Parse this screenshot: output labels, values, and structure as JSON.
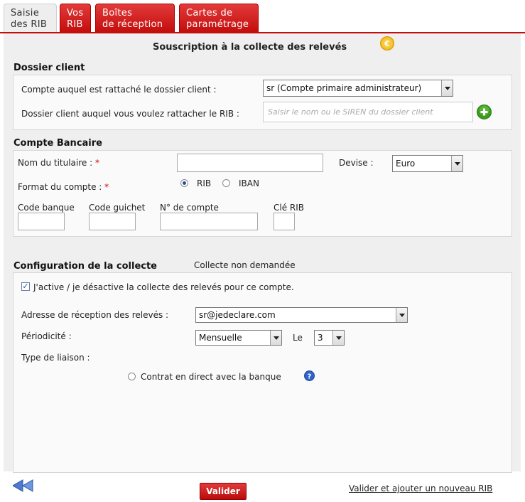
{
  "tabs": [
    {
      "label_line1": "Saisie",
      "label_line2": "des RIB"
    },
    {
      "label_line1": "Vos",
      "label_line2": "RIB"
    },
    {
      "label_line1": "Boîtes",
      "label_line2": "de réception"
    },
    {
      "label_line1": "Cartes de",
      "label_line2": "paramétrage"
    }
  ],
  "page_title": "Souscription à la collecte des relevés",
  "icons": {
    "currency": "euro-coin-icon",
    "add": "plus-circle-icon",
    "help": "question-icon",
    "back": "double-arrow-left-icon"
  },
  "dossier": {
    "title": "Dossier client",
    "compte_label": "Compte auquel est rattaché le dossier client :",
    "compte_value": "sr (Compte primaire administrateur)",
    "rattacher_label": "Dossier client auquel vous voulez rattacher le RIB :",
    "rattacher_placeholder": "Saisir le nom ou le SIREN du dossier client"
  },
  "compte": {
    "title": "Compte Bancaire",
    "titulaire_label": "Nom du titulaire :",
    "required_mark": "*",
    "devise_label": "Devise :",
    "devise_value": "Euro",
    "format_label": "Format du compte :",
    "format_rib": "RIB",
    "format_iban": "IBAN",
    "code_banque": "Code banque",
    "code_guichet": "Code guichet",
    "numero_compte": "N° de compte",
    "cle_rib": "Clé RIB"
  },
  "config": {
    "title": "Configuration de la collecte",
    "status": "Collecte non demandée",
    "checkbox_label": "J'active / je désactive la collecte des relevés pour ce compte.",
    "adresse_label": "Adresse de réception des relevés :",
    "adresse_value": "sr@jedeclare.com",
    "periodicite_label": "Périodicité :",
    "periodicite_value": "Mensuelle",
    "le_label": "Le",
    "le_value": "3",
    "liaison_label": "Type de liaison :",
    "contrat_label": "Contrat en direct avec la banque"
  },
  "footer": {
    "valider": "Valider",
    "valider_nouveau": "Valider et ajouter un nouveau RIB"
  }
}
